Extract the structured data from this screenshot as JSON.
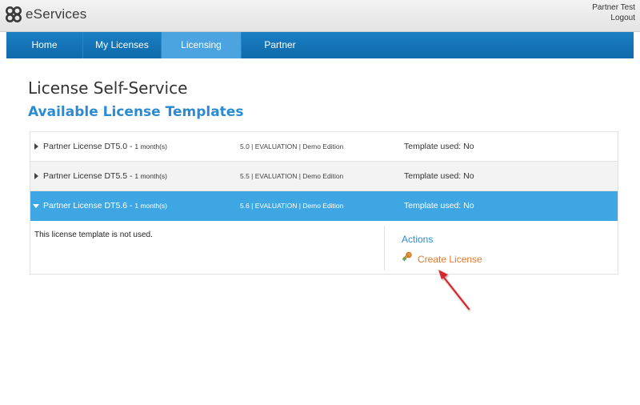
{
  "header": {
    "logo_text": "eServices",
    "user_name": "Partner Test",
    "logout_label": "Logout"
  },
  "nav": {
    "items": [
      {
        "label": "Home"
      },
      {
        "label": "My Licenses"
      },
      {
        "label": "Licensing"
      },
      {
        "label": "Partner"
      }
    ],
    "active": "Licensing"
  },
  "page": {
    "title": "License Self-Service",
    "section_title": "Available License Templates"
  },
  "templates": [
    {
      "name": "Partner License DT5.0 - ",
      "duration": "1 month(s)",
      "version": "5.0 | EVALUATION | Demo Edition",
      "used": "Template used: No"
    },
    {
      "name": "Partner License DT5.5 - ",
      "duration": "1 month(s)",
      "version": "5.5 | EVALUATION | Demo Edition",
      "used": "Template used: No"
    },
    {
      "name": "Partner License DT5.6 - ",
      "duration": "1 month(s)",
      "version": "5.6 | EVALUATION | Demo Edition",
      "used": "Template used: No"
    }
  ],
  "detail": {
    "message": "This license template is not used.",
    "actions_title": "Actions",
    "create_label": "Create License"
  },
  "colors": {
    "nav_bg": "#1a7fc3",
    "nav_active": "#4ba4e0",
    "selected_row": "#3fa6e4",
    "accent_blue": "#2a8bd2",
    "action_orange": "#e07a2e",
    "annotation_red": "#d9262b"
  },
  "icons": {
    "logo": "eservices-logo-icon",
    "create": "key-plus-icon",
    "annotation": "red-arrow-annotation"
  }
}
